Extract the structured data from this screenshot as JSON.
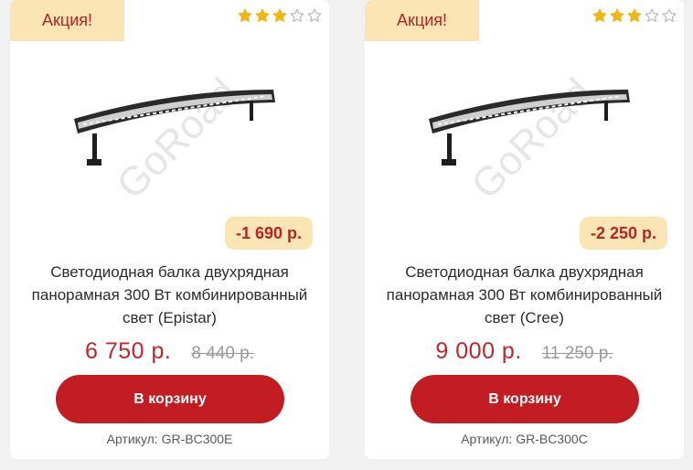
{
  "products": [
    {
      "promo_label": "Акция!",
      "rating": {
        "value": 3,
        "max": 5
      },
      "watermark": "GoRoad",
      "discount": "-1 690 р.",
      "title": "Светодиодная балка двухрядная панорамная 300 Вт комбинированный свет (Epistar)",
      "price": "6 750 р.",
      "old_price": "8 440 р.",
      "cart_label": "В корзину",
      "sku": "Артикул: GR-BC300E"
    },
    {
      "promo_label": "Акция!",
      "rating": {
        "value": 3,
        "max": 5
      },
      "watermark": "GoRoad",
      "discount": "-2 250 р.",
      "title": "Светодиодная балка двухрядная панорамная 300 Вт комбинированный свет (Cree)",
      "price": "9 000 р.",
      "old_price": "11 250 р.",
      "cart_label": "В корзину",
      "sku": "Артикул: GR-BC300C"
    }
  ],
  "colors": {
    "star_filled": "#f2b515",
    "star_empty": "#b8b8b8",
    "accent_red": "#c21d22",
    "badge_bg": "#fbe5b5"
  },
  "icons": {
    "star": "star-icon",
    "product": "led-light-bar-image"
  }
}
